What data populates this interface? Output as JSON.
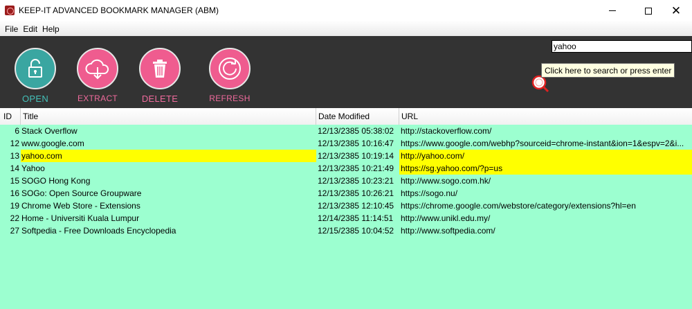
{
  "window": {
    "title": "KEEP-IT ADVANCED BOOKMARK MANAGER (ABM)",
    "icon": "app-logo-icon"
  },
  "menu": [
    "File",
    "Edit",
    "Help"
  ],
  "toolbar": {
    "open_label": "OPEN",
    "extract_label": "EXTRACT",
    "delete_label": "DELETE",
    "refresh_label": "REFRESH"
  },
  "search": {
    "value": "yahoo",
    "tooltip": "Click here to search or press enter"
  },
  "table": {
    "columns": [
      "ID",
      "Title",
      "Date Modified",
      "URL"
    ],
    "rows": [
      {
        "id": "6",
        "title": "Stack Overflow",
        "date": "12/13/2385 05:38:02",
        "url": "http://stackoverflow.com/"
      },
      {
        "id": "12",
        "title": "www.google.com",
        "date": "12/13/2385 10:16:47",
        "url": "https://www.google.com/webhp?sourceid=chrome-instant&ion=1&espv=2&i..."
      },
      {
        "id": "13",
        "title": "yahoo.com",
        "date": "12/13/2385 10:19:14",
        "url": "http://yahoo.com/"
      },
      {
        "id": "14",
        "title": "Yahoo",
        "date": "12/13/2385 10:21:49",
        "url": "https://sg.yahoo.com/?p=us"
      },
      {
        "id": "15",
        "title": "SOGO Hong Kong",
        "date": "12/13/2385 10:23:21",
        "url": "http://www.sogo.com.hk/"
      },
      {
        "id": "16",
        "title": "SOGo: Open Source Groupware",
        "date": "12/13/2385 10:26:21",
        "url": "https://sogo.nu/"
      },
      {
        "id": "19",
        "title": "Chrome Web Store - Extensions",
        "date": "12/13/2385 12:10:45",
        "url": "https://chrome.google.com/webstore/category/extensions?hl=en"
      },
      {
        "id": "22",
        "title": "Home - Universiti Kuala Lumpur",
        "date": "12/14/2385 11:14:51",
        "url": "http://www.unikl.edu.my/"
      },
      {
        "id": "27",
        "title": "Softpedia - Free Downloads Encyclopedia",
        "date": "12/15/2385 10:04:52",
        "url": "http://www.softpedia.com/"
      }
    ]
  },
  "colors": {
    "toolbar_bg": "#333333",
    "table_bg": "#9cffd0",
    "highlight": "#ffff00",
    "open_accent": "#3aa6a1",
    "action_accent": "#ef5c8f"
  }
}
